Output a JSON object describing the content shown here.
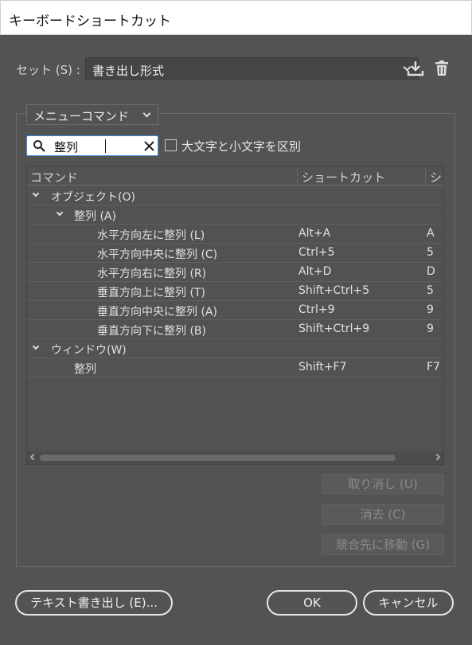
{
  "window": {
    "title": "キーボードショートカット"
  },
  "set": {
    "label": "セット (S) :",
    "value": "書き出し形式",
    "save_icon": "download-icon",
    "delete_icon": "trash-icon"
  },
  "mode": {
    "value": "メニューコマンド"
  },
  "search": {
    "value": "整列",
    "icon": "search-icon",
    "clear_icon": "close-icon"
  },
  "case_option": {
    "label": "大文字と小文字を区別",
    "checked": false
  },
  "table": {
    "headers": [
      "コマンド",
      "ショートカット",
      "シ"
    ],
    "rows": [
      {
        "level": 0,
        "expanded": true,
        "command": "オブジェクト(O)",
        "shortcut": "",
        "symbol": ""
      },
      {
        "level": 1,
        "expanded": true,
        "command": "整列 (A)",
        "shortcut": "",
        "symbol": ""
      },
      {
        "level": 3,
        "command": "水平方向左に整列 (L)",
        "shortcut": "Alt+A",
        "symbol": "A"
      },
      {
        "level": 3,
        "command": "水平方向中央に整列 (C)",
        "shortcut": "Ctrl+5",
        "symbol": "5"
      },
      {
        "level": 3,
        "command": "水平方向右に整列 (R)",
        "shortcut": "Alt+D",
        "symbol": "D"
      },
      {
        "level": 3,
        "command": "垂直方向上に整列 (T)",
        "shortcut": "Shift+Ctrl+5",
        "symbol": "5"
      },
      {
        "level": 3,
        "command": "垂直方向中央に整列 (A)",
        "shortcut": "Ctrl+9",
        "symbol": "9"
      },
      {
        "level": 3,
        "command": "垂直方向下に整列 (B)",
        "shortcut": "Shift+Ctrl+9",
        "symbol": "9"
      },
      {
        "level": 0,
        "expanded": true,
        "command": "ウィンドウ(W)",
        "shortcut": "",
        "symbol": ""
      },
      {
        "level": 2,
        "command": "整列",
        "shortcut": "Shift+F7",
        "symbol": "F7"
      }
    ]
  },
  "buttons": {
    "undo": "取り消し (U)",
    "clear": "消去 (C)",
    "goto_conflict": "競合先に移動 (G)",
    "export_text": "テキスト書き出し (E)...",
    "ok": "OK",
    "cancel": "キャンセル"
  },
  "colors": {
    "background": "#535353",
    "accent": "#3c8bd9"
  }
}
